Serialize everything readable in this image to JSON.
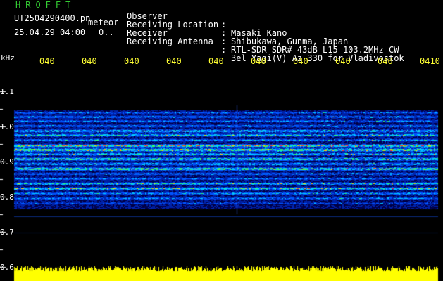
{
  "header": {
    "logo": "HROFFT",
    "filename": "UT2504290400.pn",
    "meteor": "meteor",
    "datetime": "25.04.29 04:00",
    "count": "0.."
  },
  "info": [
    {
      "key": "Observer",
      "colon": ":",
      "value": "Masaki Kano"
    },
    {
      "key": "Receiving Location",
      "colon": ":",
      "value": "Shibukawa, Gunma, Japan"
    },
    {
      "key": "Receiver",
      "colon": ":",
      "value": "RTL-SDR SDR# 43dB L15 103.2MHz CW"
    },
    {
      "key": "Receiving Antenna",
      "colon": ":",
      "value": "3el Yagi(V) Az 330 for Vladivostok"
    }
  ],
  "y_axis": {
    "unit": "kHz",
    "ticks": [
      "1.1",
      "1.0",
      "0.9",
      "0.8",
      "0.7",
      "0.6"
    ]
  },
  "x_axis": {
    "ticks": [
      "040",
      "040",
      "040",
      "040",
      "040",
      "040",
      "040",
      "040",
      "040",
      "0410"
    ]
  },
  "colors": {
    "background": "#000000",
    "logo": "#33cc33",
    "text": "#ffffff",
    "axis_time": "#ffff33",
    "noise_bar": "#ffff00"
  }
}
